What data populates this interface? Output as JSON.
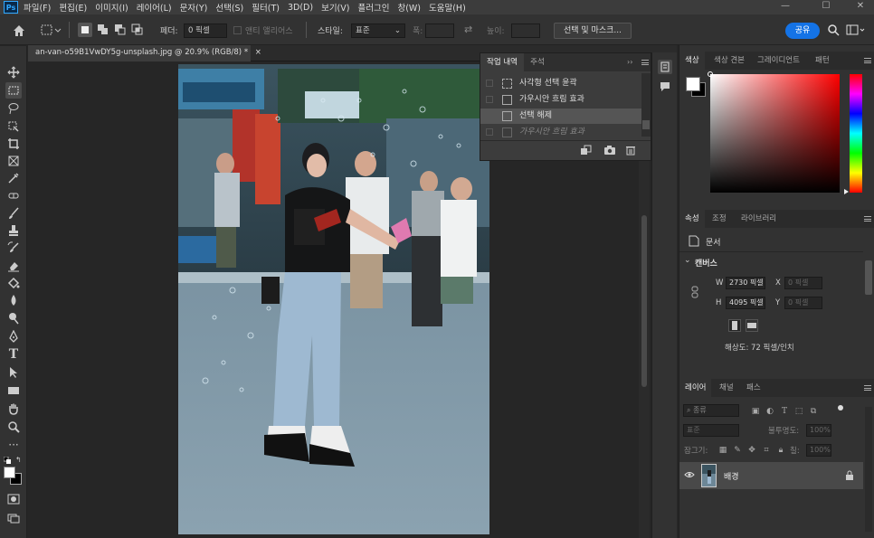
{
  "app": {
    "logo": "Ps"
  },
  "menu": [
    "파일(F)",
    "편집(E)",
    "이미지(I)",
    "레이어(L)",
    "문자(Y)",
    "선택(S)",
    "필터(T)",
    "3D(D)",
    "보기(V)",
    "플러그인",
    "창(W)",
    "도움말(H)"
  ],
  "window_controls": {
    "minimize": "—",
    "maximize": "☐",
    "close": "✕"
  },
  "options": {
    "feather_label": "페더:",
    "feather_value": "0 픽셀",
    "antialias_label": "앤티 앨리어스",
    "style_label": "스타일:",
    "style_value": "표준",
    "width_label": "폭:",
    "height_label": "높이:",
    "select_mask_button": "선택 및 마스크...",
    "share_button": "공유"
  },
  "document": {
    "tab_title": "an-van-o59B1VwDY5g-unsplash.jpg @ 20.9% (RGB/8) *",
    "tab_close": "×"
  },
  "history_panel": {
    "tabs": [
      "작업 내역",
      "주석"
    ],
    "items": [
      {
        "label": "사각형 선택 윤곽",
        "state": "normal"
      },
      {
        "label": "가우시안 흐림 효과",
        "state": "normal"
      },
      {
        "label": "선택 해제",
        "state": "selected"
      },
      {
        "label": "가우시안 흐림 효과",
        "state": "dimmed"
      }
    ]
  },
  "color_panel": {
    "tabs": [
      "색상",
      "색상 견본",
      "그레이디언트",
      "패턴"
    ],
    "foreground": "#ffffff",
    "background": "#000000",
    "hue_color": "#ff0000"
  },
  "properties_panel": {
    "tabs": [
      "속성",
      "조정",
      "라이브러리"
    ],
    "doc_label": "문서",
    "canvas_label": "캔버스",
    "w_label": "W",
    "w_value": "2730 픽셀",
    "h_label": "H",
    "h_value": "4095 픽셀",
    "x_label": "X",
    "x_value": "0 픽셀",
    "y_label": "Y",
    "y_value": "0 픽셀",
    "resolution": "해상도: 72 픽셀/인치"
  },
  "layers_panel": {
    "tabs": [
      "레이어",
      "채널",
      "패스"
    ],
    "filter_placeholder": "종류",
    "blend_mode": "표준",
    "opacity_label": "불투명도:",
    "opacity_value": "100%",
    "lock_label": "잠그기:",
    "fill_label": "칠:",
    "fill_value": "100%",
    "layers": [
      {
        "name": "배경",
        "visible": true,
        "locked": true
      }
    ]
  },
  "colors": {
    "accent": "#1473e6",
    "panel_bg": "#323232",
    "canvas_bg": "#262626"
  }
}
